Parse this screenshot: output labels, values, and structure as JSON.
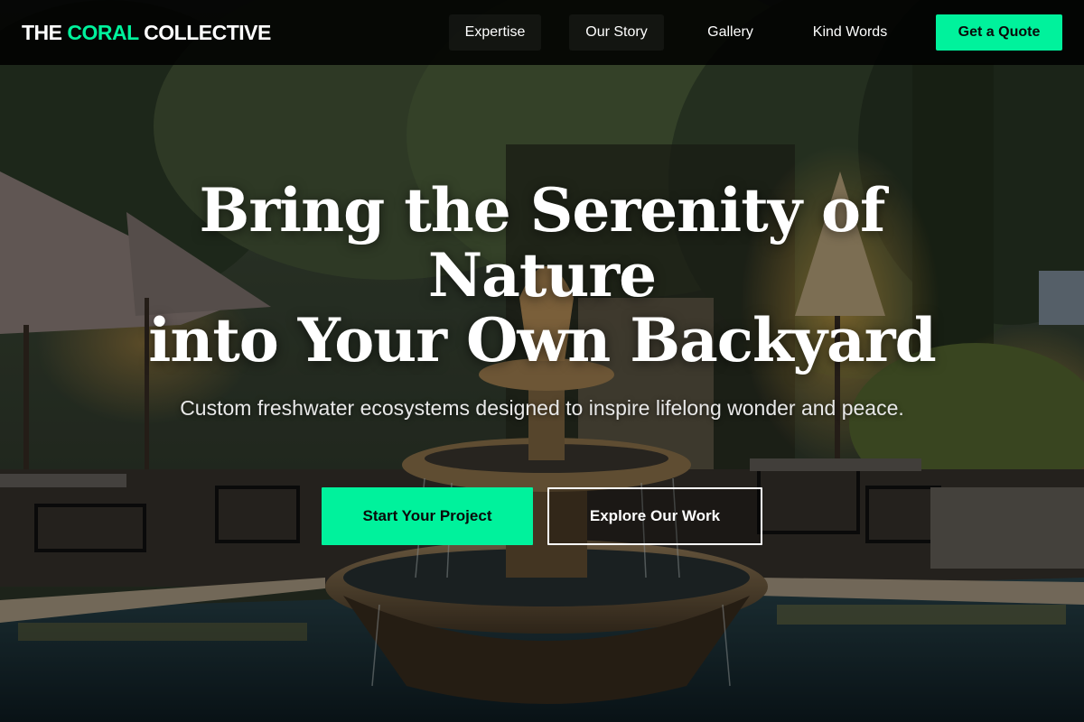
{
  "nav": {
    "logo_part1": "THE ",
    "logo_accent": "CORAL",
    "logo_part2": " COLLECTIVE",
    "links": [
      {
        "label": "Expertise"
      },
      {
        "label": "Our Story"
      },
      {
        "label": "Gallery"
      },
      {
        "label": "Kind Words"
      }
    ],
    "cta_label": "Get a Quote"
  },
  "hero": {
    "title_line1": "Bring the Serenity of",
    "title_line2": "Nature",
    "title_line3": "into Your Own Backyard",
    "subtitle": "Custom freshwater ecosystems designed to inspire lifelong wonder and peace.",
    "primary_cta": "Start Your Project",
    "secondary_cta": "Explore Our Work",
    "background": "photo: illuminated stone fountain on a patio with umbrellas, bistro chairs and ivy-covered trees at dusk"
  },
  "colors": {
    "accent": "#00f29c",
    "nav_background": "#000000",
    "text": "#ffffff"
  }
}
